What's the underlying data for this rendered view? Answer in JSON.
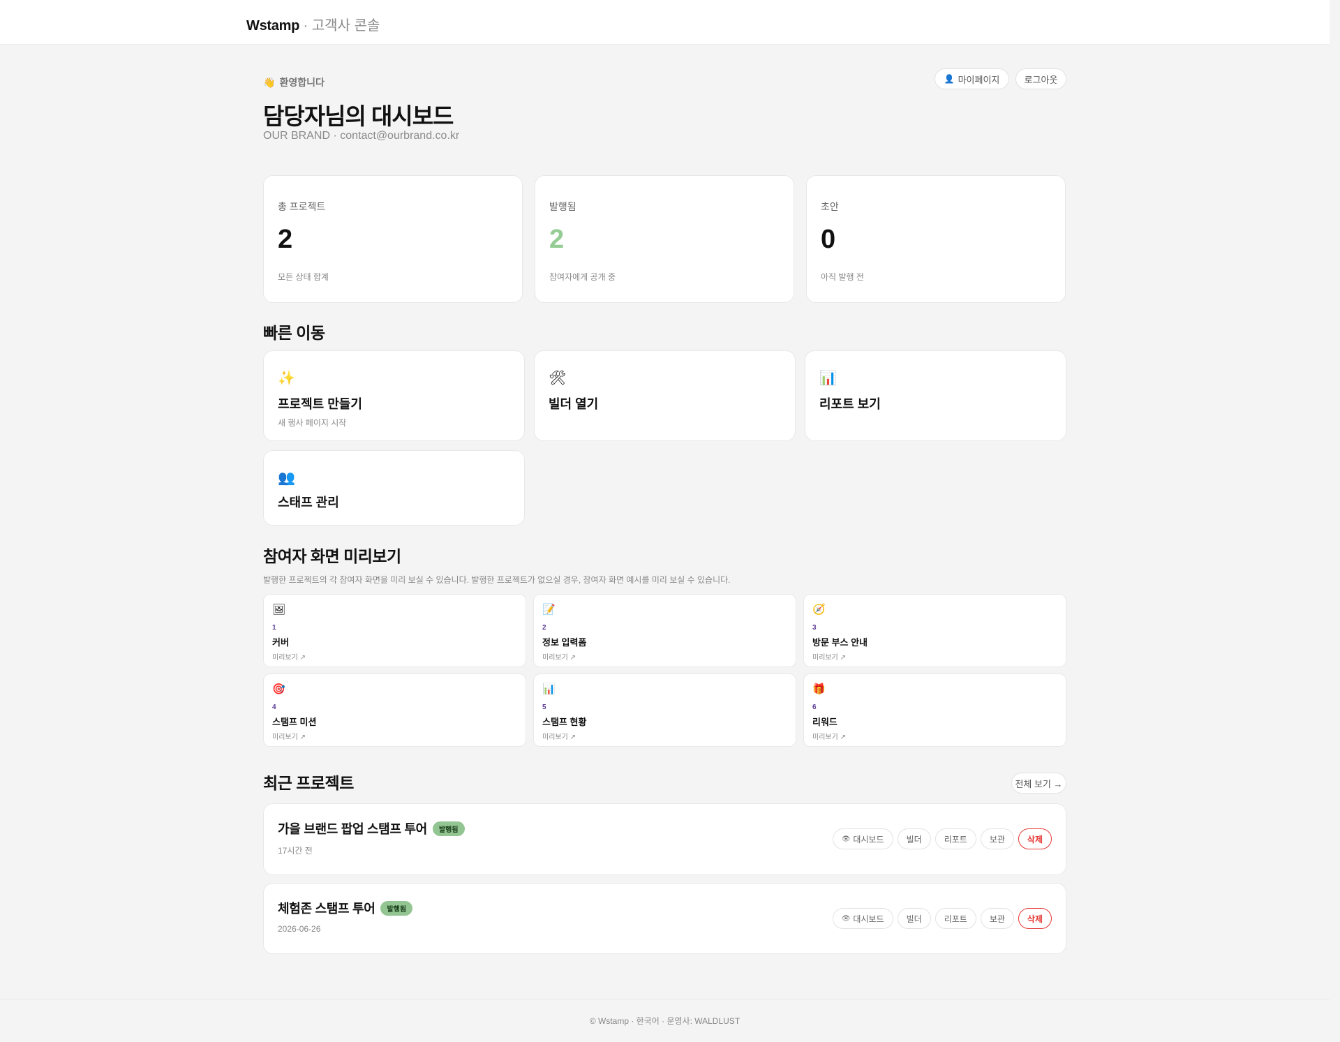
{
  "header": {
    "logo": "Wstamp",
    "separator": "·",
    "subtitle": "고객사 콘솔"
  },
  "welcome": {
    "emoji": "👋",
    "greeting": "환영합니다",
    "title": "담당자님의 대시보드",
    "account": "OUR BRAND · contact@ourbrand.co.kr"
  },
  "top_actions": {
    "mypage_icon": "👤",
    "mypage": "마이페이지",
    "logout": "로그아웃"
  },
  "stats": [
    {
      "label": "총 프로젝트",
      "value": "2",
      "note": "모든 상태 합계",
      "color": "#111111"
    },
    {
      "label": "발행됨",
      "value": "2",
      "note": "참여자에게 공개 중",
      "color": "#94cc94"
    },
    {
      "label": "초안",
      "value": "0",
      "note": "아직 발행 전",
      "color": "#111111"
    }
  ],
  "quick": {
    "title": "빠른 이동",
    "items": [
      {
        "icon": "✨",
        "icon_name": "sparkles-icon",
        "label": "프로젝트 만들기",
        "sub": "새 행사 페이지 시작"
      },
      {
        "icon": "🛠",
        "icon_name": "tools-icon",
        "label": "빌더 열기",
        "sub": ""
      },
      {
        "icon": "📊",
        "icon_name": "bar-chart-icon",
        "label": "리포트 보기",
        "sub": ""
      },
      {
        "icon": "👥",
        "icon_name": "users-icon",
        "label": "스태프 관리",
        "sub": ""
      }
    ]
  },
  "preview": {
    "title": "참여자 화면 미리보기",
    "description": "발행한 프로젝트의 각 참여자 화면을 미리 보실 수 있습니다. 발행한 프로젝트가 없으실 경우, 참여자 화면 예시를 미리 보실 수 있습니다.",
    "link": "미리보기 ↗",
    "items": [
      {
        "icon": "🖼",
        "icon_name": "picture-icon",
        "num": "1",
        "label": "커버"
      },
      {
        "icon": "📝",
        "icon_name": "memo-icon",
        "num": "2",
        "label": "정보 입력폼"
      },
      {
        "icon": "🧭",
        "icon_name": "compass-icon",
        "num": "3",
        "label": "방문 부스 안내"
      },
      {
        "icon": "🎯",
        "icon_name": "target-icon",
        "num": "4",
        "label": "스탬프 미션"
      },
      {
        "icon": "📊",
        "icon_name": "bar-chart-icon",
        "num": "5",
        "label": "스탬프 현황"
      },
      {
        "icon": "🎁",
        "icon_name": "gift-icon",
        "num": "6",
        "label": "리워드"
      }
    ]
  },
  "recent": {
    "title": "최근 프로젝트",
    "view_all": "전체 보기 →",
    "projects": [
      {
        "name": "가을 브랜드 팝업 스탬프 투어",
        "status": "발행됨",
        "date": "17시간 전"
      },
      {
        "name": "체험존 스탬프 투어",
        "status": "발행됨",
        "date": "2026-06-26"
      }
    ],
    "actions": {
      "dashboard_icon": "👁",
      "dashboard": "대시보드",
      "builder": "빌더",
      "report": "리포트",
      "archive": "보관",
      "delete": "삭제"
    }
  },
  "footer": {
    "text": "© Wstamp · 한국어 · 운영사: WALDLUST"
  }
}
